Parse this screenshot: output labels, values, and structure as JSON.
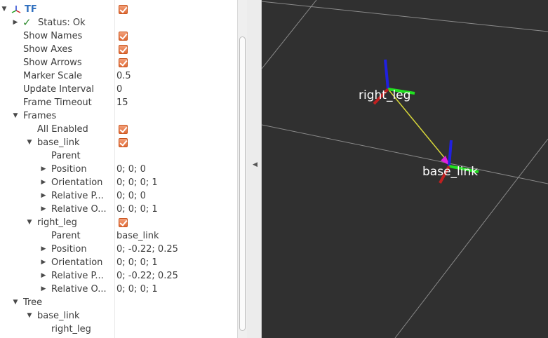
{
  "tf_display": {
    "title": "TF",
    "status": "Status: Ok",
    "properties": [
      {
        "label": "Show Names",
        "checked": true
      },
      {
        "label": "Show Axes",
        "checked": true
      },
      {
        "label": "Show Arrows",
        "checked": true
      },
      {
        "label": "Marker Scale",
        "value": "0.5"
      },
      {
        "label": "Update Interval",
        "value": "0"
      },
      {
        "label": "Frame Timeout",
        "value": "15"
      }
    ],
    "frames": {
      "label": "Frames",
      "all_enabled": "All Enabled",
      "items": [
        {
          "name": "base_link",
          "rows": [
            {
              "label": "Parent",
              "value": ""
            },
            {
              "label": "Position",
              "value": "0; 0; 0"
            },
            {
              "label": "Orientation",
              "value": "0; 0; 0; 1"
            },
            {
              "label": "Relative P...",
              "value": "0; 0; 0"
            },
            {
              "label": "Relative O...",
              "value": "0; 0; 0; 1"
            }
          ]
        },
        {
          "name": "right_leg",
          "rows": [
            {
              "label": "Parent",
              "value": "base_link"
            },
            {
              "label": "Position",
              "value": "0; -0.22; 0.25"
            },
            {
              "label": "Orientation",
              "value": "0; 0; 0; 1"
            },
            {
              "label": "Relative P...",
              "value": "0; -0.22; 0.25"
            },
            {
              "label": "Relative O...",
              "value": "0; 0; 0; 1"
            }
          ]
        }
      ]
    },
    "tree": {
      "label": "Tree",
      "root": "base_link",
      "child": "right_leg"
    }
  },
  "viewport": {
    "frame_labels": [
      "right_leg",
      "base_link"
    ],
    "colors": {
      "background": "#303030",
      "grid": "#8a8a8a",
      "x_axis": "#e02020",
      "y_axis": "#20e020",
      "z_axis": "#2020e0",
      "link_arrow": "#e0e020",
      "arrow_head": "#e020e0"
    }
  },
  "icons": {
    "tf": "tf-frame-icon",
    "status_ok": "check-mark-icon",
    "expand": "triangle-right-icon",
    "collapse": "triangle-down-icon"
  }
}
